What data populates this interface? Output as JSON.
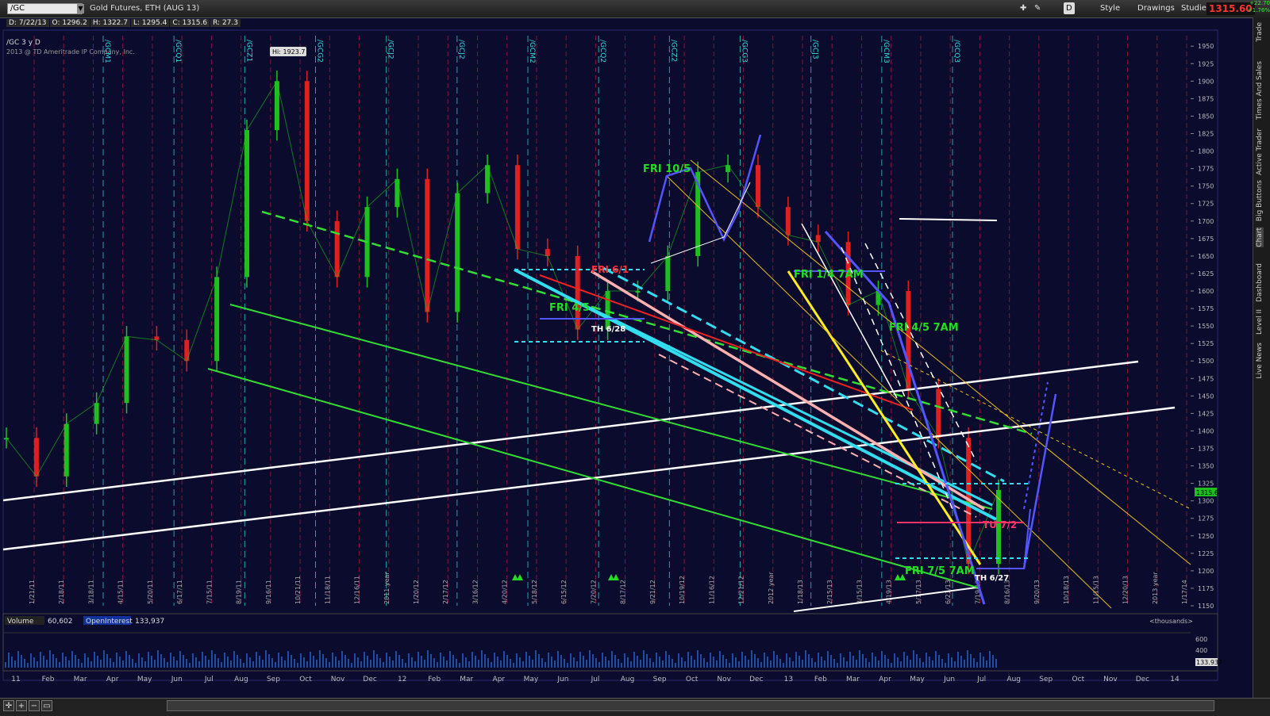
{
  "toolbar": {
    "symbol": "/GC",
    "instrument": "Gold Futures, ETH (AUG 13)",
    "d_button": "D",
    "style_label": "Style",
    "drawings_label": "Drawings",
    "studies_label": "Studies",
    "last_price": "1315.60",
    "change_abs": "+22.70",
    "change_pct": "+1.76%"
  },
  "header": {
    "ohlc": [
      "D: 7/22/13",
      "O: 1296.2",
      "H: 1322.7",
      "L: 1295.4",
      "C: 1315.6",
      "R: 27.3"
    ],
    "chart_label": "/GC 3 y D",
    "copyright": "2013 @ TD Ameritrade IP Company, Inc."
  },
  "sidebar_tabs": [
    "Trade",
    "Times And Sales",
    "Active Trader",
    "Big Buttons",
    "Chart",
    "Dashboard",
    "Level II",
    "Live News"
  ],
  "colors": {
    "up": "#1fbf1f",
    "down": "#e02020",
    "bg": "#0b0b2e",
    "grid": "#3a3a8a"
  },
  "chart_data": {
    "type": "line",
    "price_axis": {
      "ylim": [
        1150,
        1965
      ],
      "ticks": [
        1150,
        1175,
        1200,
        1225,
        1250,
        1275,
        1300,
        1325,
        1350,
        1375,
        1400,
        1425,
        1450,
        1475,
        1500,
        1525,
        1550,
        1575,
        1600,
        1625,
        1650,
        1675,
        1700,
        1725,
        1750,
        1775,
        1800,
        1825,
        1850,
        1875,
        1900,
        1925,
        1950
      ],
      "last_label": "1315.6"
    },
    "hi_label": "Hi: 1923.7",
    "date_labels": [
      "1/21/11",
      "2/18/11",
      "3/18/11",
      "4/15/11",
      "5/20/11",
      "6/17/11",
      "7/15/11",
      "8/19/11",
      "9/16/11",
      "10/21/11",
      "11/18/11",
      "12/16/11",
      "2011 year",
      "1/20/12",
      "2/17/12",
      "3/16/12",
      "4/20/12",
      "5/18/12",
      "6/15/12",
      "7/20/12",
      "8/17/12",
      "9/21/12",
      "10/19/12",
      "11/16/12",
      "12/21/12",
      "2012 year",
      "1/18/13",
      "2/15/13",
      "3/15/13",
      "4/19/13",
      "5/17/13",
      "6/21/13",
      "7/19/13",
      "8/16/13",
      "9/20/13",
      "10/18/13",
      "11/15/13",
      "12/20/13",
      "2013 year",
      "1/17/14"
    ],
    "contract_labels": [
      "/GCM1",
      "/GCQ1",
      "/GCZ1",
      "/GCG2",
      "/GCJ2",
      "/GCJ2",
      "/GCM2",
      "/GCQ2",
      "/GCZ2",
      "/GCG3",
      "/GCJ3",
      "/GCM3",
      "/GCQ3"
    ],
    "month_labels": [
      "11",
      "Feb",
      "Mar",
      "Apr",
      "May",
      "Jun",
      "Jul",
      "Aug",
      "Sep",
      "Oct",
      "Nov",
      "Dec",
      "12",
      "Feb",
      "Mar",
      "Apr",
      "May",
      "Jun",
      "Jul",
      "Aug",
      "Sep",
      "Oct",
      "Nov",
      "Dec",
      "13",
      "Feb",
      "Mar",
      "Apr",
      "May",
      "Jun",
      "Jul",
      "Aug",
      "Sep",
      "Oct",
      "Nov",
      "Dec",
      "14"
    ],
    "price_series": [
      {
        "date": "2010-12",
        "close": 1390
      },
      {
        "date": "2011-01",
        "close": 1335
      },
      {
        "date": "2011-02",
        "close": 1410
      },
      {
        "date": "2011-03",
        "close": 1440
      },
      {
        "date": "2011-04",
        "close": 1535
      },
      {
        "date": "2011-05",
        "close": 1530
      },
      {
        "date": "2011-06",
        "close": 1500
      },
      {
        "date": "2011-07",
        "close": 1620
      },
      {
        "date": "2011-08",
        "close": 1830
      },
      {
        "date": "2011-08b",
        "close": 1900
      },
      {
        "date": "2011-09",
        "close": 1700
      },
      {
        "date": "2011-09b",
        "close": 1620
      },
      {
        "date": "2011-10",
        "close": 1720
      },
      {
        "date": "2011-11",
        "close": 1760
      },
      {
        "date": "2011-12",
        "close": 1570
      },
      {
        "date": "2012-01",
        "close": 1740
      },
      {
        "date": "2012-02",
        "close": 1780
      },
      {
        "date": "2012-03",
        "close": 1660
      },
      {
        "date": "2012-04",
        "close": 1650
      },
      {
        "date": "2012-05",
        "close": 1545
      },
      {
        "date": "2012-06",
        "close": 1600
      },
      {
        "date": "2012-07",
        "close": 1600
      },
      {
        "date": "2012-08",
        "close": 1650
      },
      {
        "date": "2012-09",
        "close": 1770
      },
      {
        "date": "2012-10",
        "close": 1780
      },
      {
        "date": "2012-11",
        "close": 1720
      },
      {
        "date": "2012-12",
        "close": 1680
      },
      {
        "date": "2013-01",
        "close": 1670
      },
      {
        "date": "2013-02",
        "close": 1580
      },
      {
        "date": "2013-03",
        "close": 1600
      },
      {
        "date": "2013-04",
        "close": 1460
      },
      {
        "date": "2013-05",
        "close": 1390
      },
      {
        "date": "2013-06",
        "close": 1210
      },
      {
        "date": "2013-07",
        "close": 1315.6
      }
    ],
    "annotations": [
      {
        "text": "FRI 10/5",
        "color": "#22dd22"
      },
      {
        "text": "FRI 1/4 7AM",
        "color": "#22dd22"
      },
      {
        "text": "FRI 4/5 7AM",
        "color": "#22dd22"
      },
      {
        "text": "FRI 7/5 7AM",
        "color": "#22dd22"
      },
      {
        "text": "FRI 4/5",
        "color": "#22dd22"
      },
      {
        "text": "TH 6/28",
        "color": "#ffffff"
      },
      {
        "text": "TH 6/27",
        "color": "#ffffff"
      },
      {
        "text": "TU 7/2",
        "color": "#ff3366"
      },
      {
        "text": "FRI 6/1",
        "color": "#ff3333"
      }
    ],
    "volume": {
      "label": "Volume",
      "value": "60,602",
      "oi_label": "OpenInterest",
      "oi_value": "133,937",
      "units": "<thousands>",
      "ticks": [
        400,
        600
      ],
      "last_label": "133.937"
    }
  }
}
